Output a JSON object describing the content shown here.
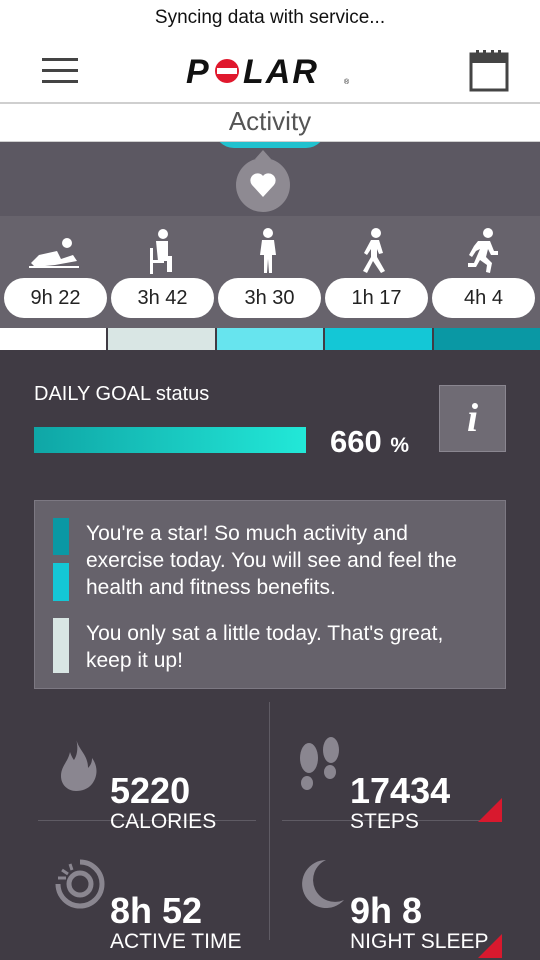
{
  "status_bar": {
    "text": "Syncing data with service..."
  },
  "header": {
    "logo_text": "POLAR",
    "menu_icon": "hamburger-menu-icon",
    "calendar_icon": "calendar-icon"
  },
  "subheader": {
    "title": "Activity"
  },
  "activity_levels": [
    {
      "name": "resting",
      "icon": "lying-down-icon",
      "duration": "9h 22",
      "color": "#ffffff"
    },
    {
      "name": "sitting",
      "icon": "sitting-icon",
      "duration": "3h 42",
      "color": "#d9e6e4"
    },
    {
      "name": "low",
      "icon": "standing-icon",
      "duration": "3h 30",
      "color": "#67e4ee"
    },
    {
      "name": "medium",
      "icon": "walking-icon",
      "duration": "1h 17",
      "color": "#14c7d6"
    },
    {
      "name": "high",
      "icon": "running-icon",
      "duration": "4h 4",
      "color": "#0a98a4"
    }
  ],
  "daily_goal": {
    "label": "DAILY GOAL status",
    "percent": "660",
    "unit": "%",
    "info_label": "i",
    "fill_fraction": 1.0
  },
  "messages": [
    {
      "text": "You're a star! So much activity and exercise today. You will see and feel the health and fitness benefits.",
      "swatch_colors": [
        "#0a98a4",
        "#14c7d6"
      ]
    },
    {
      "text": "You only sat a little today. That's great, keep it up!",
      "swatch_colors": [
        "#d9e6e4"
      ]
    }
  ],
  "stats": {
    "calories": {
      "value": "5220",
      "label": "CALORIES",
      "icon": "flame-icon"
    },
    "steps": {
      "value": "17434",
      "label": "STEPS",
      "icon": "footprints-icon"
    },
    "active_time": {
      "value": "8h 52",
      "label": "ACTIVE TIME",
      "icon": "active-time-icon"
    },
    "night_sleep": {
      "value": "9h 8",
      "label": "NIGHT SLEEP",
      "icon": "moon-icon"
    }
  },
  "colors": {
    "background": "#403b44",
    "accent": "#14c7d6",
    "alert": "#d8192e",
    "brand_red": "#e0182d"
  }
}
